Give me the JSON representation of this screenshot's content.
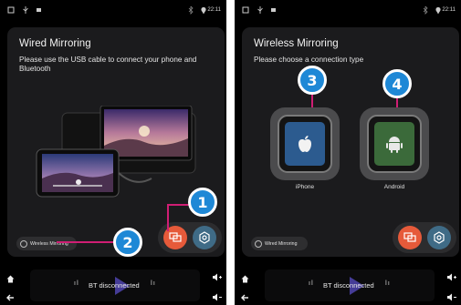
{
  "screens": [
    {
      "status": {
        "time": "22:11"
      },
      "panel": {
        "title": "Wired Mirroring",
        "subtitle": "Please use the USB cable to connect your phone and Bluetooth"
      },
      "mode_button": "Wireless Mirroring",
      "bottom": {
        "bt_status": "BT disconnected"
      },
      "callouts": [
        "1",
        "2"
      ]
    },
    {
      "status": {
        "time": "22:11"
      },
      "panel": {
        "title": "Wireless Mirroring",
        "subtitle": "Please choose a connection type"
      },
      "connection_types": [
        {
          "label": "iPhone",
          "icon": "apple-icon",
          "color": "#2c5b8f"
        },
        {
          "label": "Android",
          "icon": "android-icon",
          "color": "#3b6a3a"
        }
      ],
      "mode_button": "Wired Mirroring",
      "bottom": {
        "bt_status": "BT disconnected"
      },
      "callouts": [
        "3",
        "4"
      ]
    }
  ],
  "colors": {
    "callout_badge": "#1e88d6",
    "callout_line": "#d01e74",
    "mirror_button": "#e65a3a",
    "settings_button": "#3f6b86"
  },
  "icons": {
    "status": [
      "square-icon",
      "usb-icon",
      "image-icon",
      "bluetooth-icon",
      "location-pin-icon"
    ],
    "actions": [
      "mirror-icon",
      "settings-icon"
    ],
    "bottom_left": [
      "home-icon",
      "back-icon"
    ],
    "bottom_right": [
      "volume-down-icon",
      "volume-up-icon"
    ]
  }
}
